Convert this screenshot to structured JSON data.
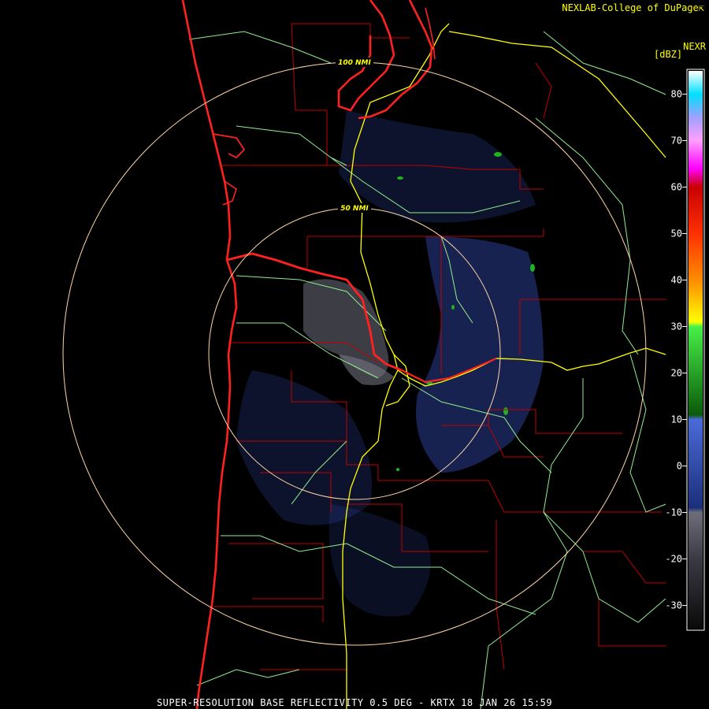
{
  "header": {
    "credit": "NEXLAB-College of DuPage",
    "credit_icon": "external-link-icon",
    "product": "NEXR",
    "units": "[dBZ]"
  },
  "footer": {
    "caption": "SUPER-RESOLUTION BASE REFLECTIVITY 0.5 DEG - KRTX 18 JAN 26 15:59"
  },
  "range_rings": [
    {
      "label": "50 NMI",
      "nmi": 50
    },
    {
      "label": "100 NMI",
      "nmi": 100
    }
  ],
  "colors": {
    "ring": "#ffd6a5",
    "state_border": "#ff2020",
    "county_border": "#c00000",
    "highway": "#ffff00",
    "road": "#90ee90",
    "weak_echo": "#6a6a78",
    "light_echo": "#3c55c8",
    "moderate_echo": "#1eb41e"
  },
  "legend": {
    "min": -30,
    "max": 80,
    "ticks": [
      80,
      70,
      60,
      50,
      40,
      30,
      20,
      10,
      0,
      -10,
      -20,
      -30
    ],
    "stops": [
      {
        "dbz": -35,
        "color": "#0a0a0a"
      },
      {
        "dbz": -20,
        "color": "#3a3a44"
      },
      {
        "dbz": -10,
        "color": "#6e6e7a"
      },
      {
        "dbz": -9,
        "color": "#1b2f7a"
      },
      {
        "dbz": 10,
        "color": "#4a6ad8"
      },
      {
        "dbz": 11,
        "color": "#0a5a0a"
      },
      {
        "dbz": 30,
        "color": "#48f048"
      },
      {
        "dbz": 31,
        "color": "#ffff00"
      },
      {
        "dbz": 40,
        "color": "#ff8c00"
      },
      {
        "dbz": 50,
        "color": "#ff3000"
      },
      {
        "dbz": 60,
        "color": "#c80000"
      },
      {
        "dbz": 64,
        "color": "#ff00ff"
      },
      {
        "dbz": 70,
        "color": "#ffa0ff"
      },
      {
        "dbz": 75,
        "color": "#a0a0ff"
      },
      {
        "dbz": 80,
        "color": "#00e0ff"
      },
      {
        "dbz": 85,
        "color": "#ffffff"
      }
    ]
  }
}
